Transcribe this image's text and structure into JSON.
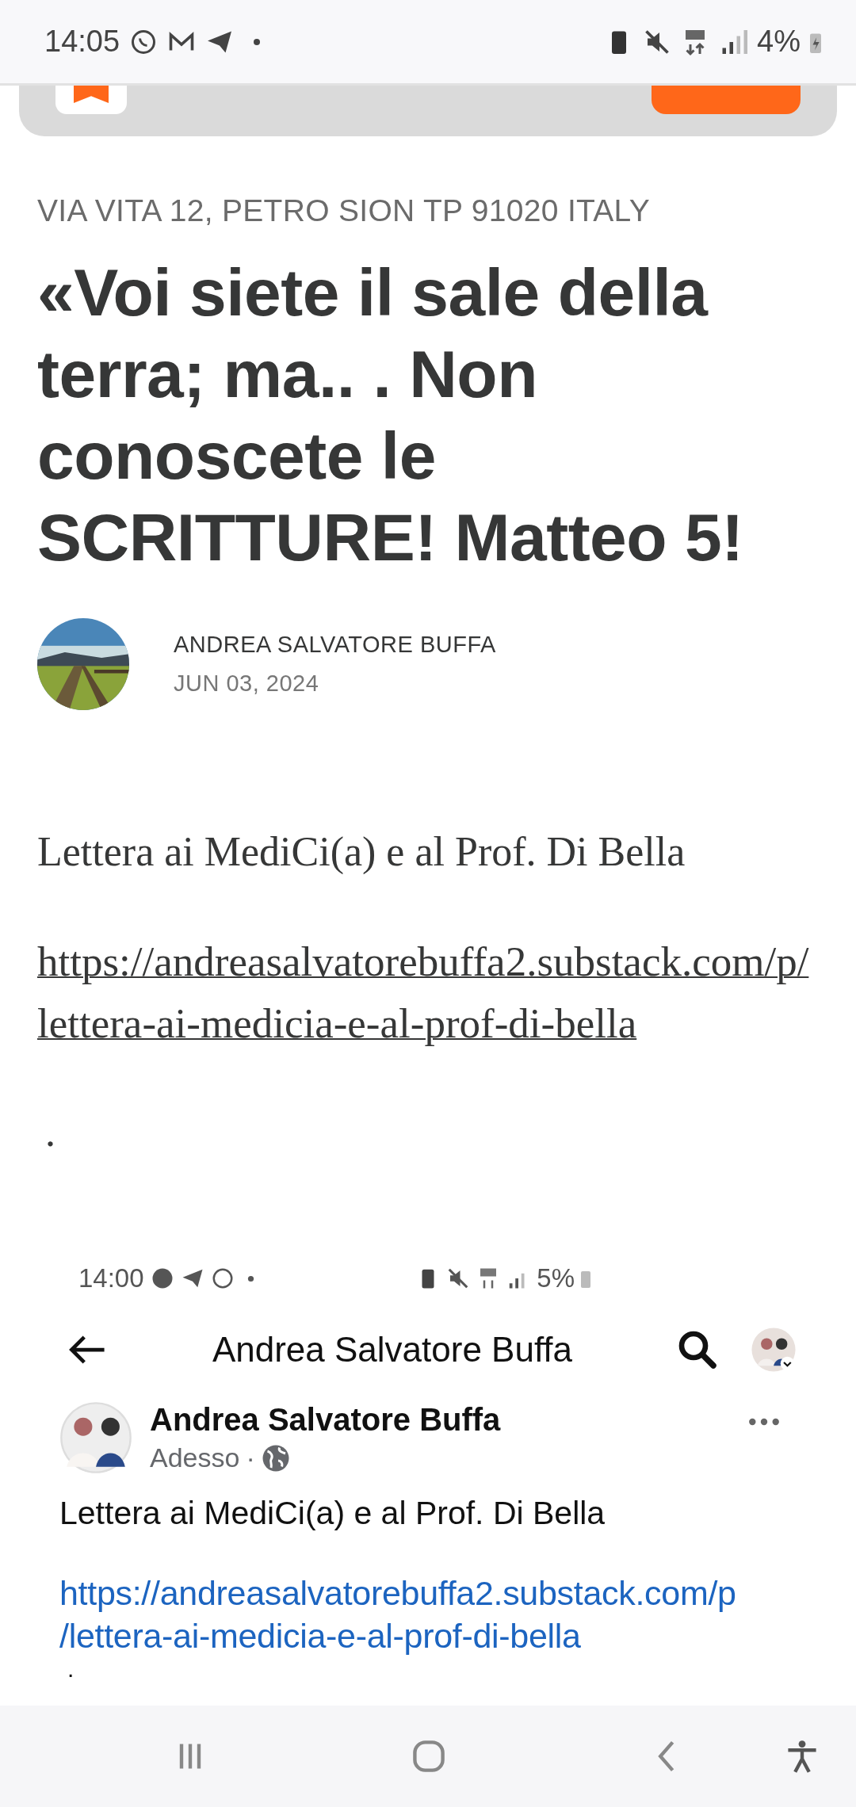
{
  "status_bar": {
    "time": "14:05",
    "battery": "4%"
  },
  "article": {
    "address": "VIA VITA 12, PETRO SION TP 91020 ITALY",
    "title": "«Voi siete il sale della terra; ma.. . Non conoscete le SCRITTURE! Matteo 5!",
    "author": "ANDREA SALVATORE BUFFA",
    "date": "JUN 03, 2024",
    "body": [
      {
        "kind": "text",
        "text": "Lettera ai MediCi(a) e al Prof. Di Bella"
      },
      {
        "kind": "link",
        "lines": [
          "https://andreasalvatorebuffa2.substack.com/p/",
          "lettera-ai-medicia-e-al-prof-di-bella"
        ]
      },
      {
        "kind": "text",
        "text": "."
      }
    ]
  },
  "embedded": {
    "status_bar": {
      "time": "14:00",
      "battery": "5%"
    },
    "header_title": "Andrea Salvatore Buffa",
    "post": {
      "author": "Andrea Salvatore Buffa",
      "time": "Adesso",
      "separator": "·",
      "text": "Lettera ai MediCi(a) e al Prof. Di Bella",
      "link_lines": [
        "https://andreasalvatorebuffa2.substack.com/p",
        "/lettera-ai-medicia-e-al-prof-di-bella"
      ],
      "trailing": "."
    }
  }
}
